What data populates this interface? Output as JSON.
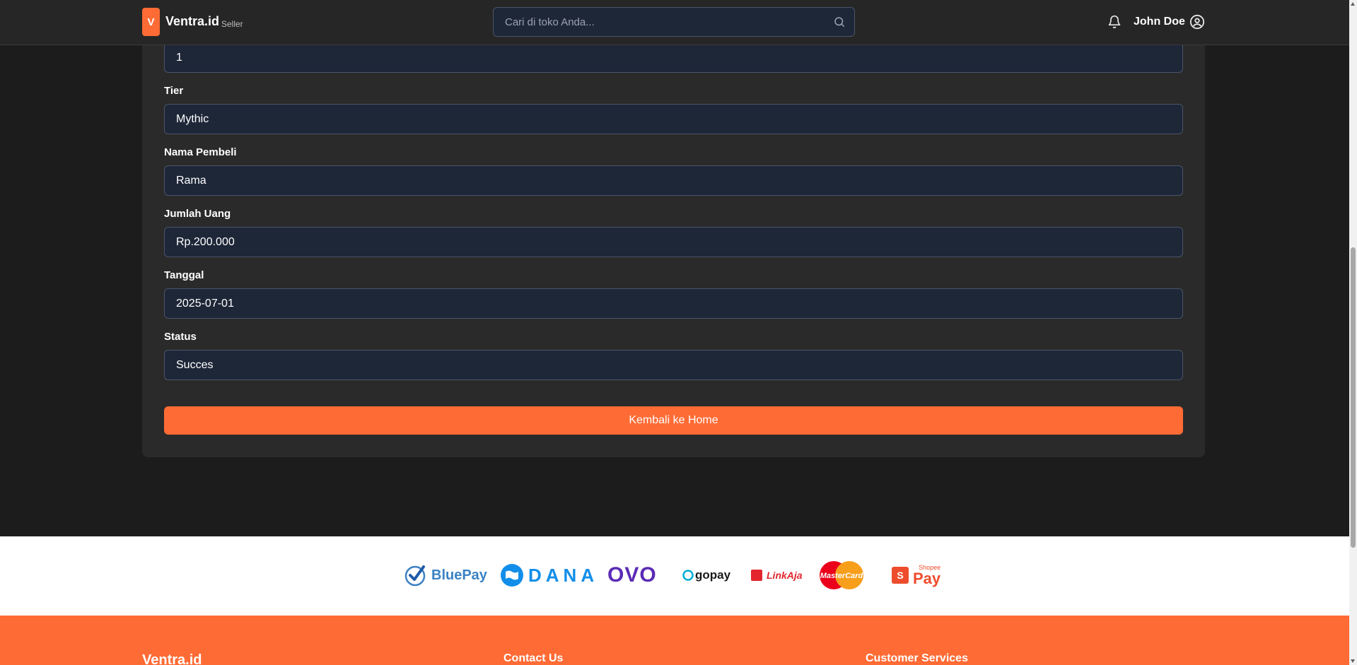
{
  "header": {
    "logo_letter": "V",
    "brand": "Ventra.id",
    "brand_sub": "Seller",
    "search_placeholder": "Cari di toko Anda...",
    "username": "John Doe"
  },
  "form": {
    "fields": [
      {
        "label": "",
        "value": "1"
      },
      {
        "label": "Tier",
        "value": "Mythic"
      },
      {
        "label": "Nama Pembeli",
        "value": "Rama"
      },
      {
        "label": "Jumlah Uang",
        "value": "Rp.200.000"
      },
      {
        "label": "Tanggal",
        "value": "2025-07-01"
      },
      {
        "label": "Status",
        "value": "Succes"
      }
    ],
    "button_label": "Kembali ke Home"
  },
  "payments": {
    "bluepay": "BluePay",
    "dana": "DANA",
    "ovo": "OVO",
    "gopay": "gopay",
    "linkaja": "LinkAja",
    "mastercard": "MasterCard",
    "shopeepay_top": "Shopee",
    "shopeepay": "Pay"
  },
  "footer": {
    "brand": "Ventra.id",
    "contact": "Contact Us",
    "customer_services": "Customer Services"
  },
  "colors": {
    "accent": "#ff6b35",
    "input_bg": "#1e2738",
    "card_bg": "#2a2a2a",
    "page_bg": "#1c1c1c"
  }
}
